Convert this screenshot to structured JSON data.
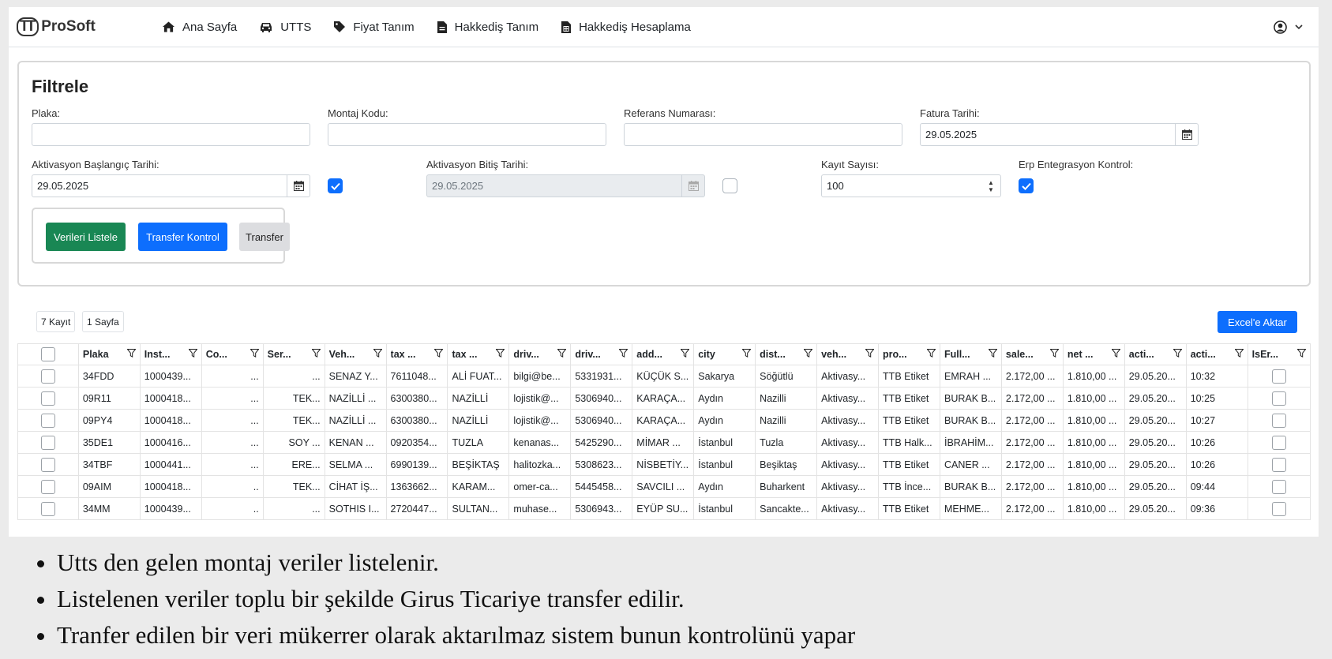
{
  "nav": {
    "logo_mark": "TT",
    "logo_text": "ProSoft",
    "items": [
      {
        "label": "Ana Sayfa",
        "icon": "home-icon"
      },
      {
        "label": "UTTS",
        "icon": "car-icon"
      },
      {
        "label": "Fiyat Tanım",
        "icon": "tag-icon"
      },
      {
        "label": "Hakkediş Tanım",
        "icon": "file-icon"
      },
      {
        "label": "Hakkediş Hesaplama",
        "icon": "calculator-file-icon"
      }
    ],
    "user_icon": "user-circle-icon"
  },
  "filter": {
    "title": "Filtrele",
    "plaka_label": "Plaka:",
    "plaka_value": "",
    "montaj_label": "Montaj Kodu:",
    "montaj_value": "",
    "referans_label": "Referans Numarası:",
    "referans_value": "",
    "fatura_label": "Fatura Tarihi:",
    "fatura_value": "29.05.2025",
    "akt_bas_label": "Aktivasyon Başlangıç Tarihi:",
    "akt_bas_value": "29.05.2025",
    "akt_bas_checked": true,
    "akt_bit_label": "Aktivasyon Bitiş Tarihi:",
    "akt_bit_value": "29.05.2025",
    "akt_bit_checked": false,
    "kayit_label": "Kayıt Sayısı:",
    "kayit_value": "100",
    "erp_label": "Erp Entegrasyon Kontrol:",
    "erp_checked": true,
    "btn_list": "Verileri Listele",
    "btn_transfer_kontrol": "Transfer Kontrol",
    "btn_transfer": "Transfer"
  },
  "grid": {
    "record_count": "7 Kayıt",
    "page_count": "1 Sayfa",
    "excel_button": "Excel'e Aktar",
    "columns": [
      "Plaka",
      "Inst...",
      "Co...",
      "Ser...",
      "Veh...",
      "tax ...",
      "tax ...",
      "driv...",
      "driv...",
      "add...",
      "city",
      "dist...",
      "veh...",
      "pro...",
      "Full...",
      "sale...",
      "net ...",
      "acti...",
      "acti...",
      "IsEr..."
    ],
    "rows": [
      [
        "34FDD",
        "1000439...",
        "...",
        "...",
        "SENAZ Y...",
        "7611048...",
        "ALİ FUAT...",
        "bilgi@be...",
        "5331931...",
        "KÜÇÜK S...",
        "Sakarya",
        "Söğütlü",
        "Aktivasy...",
        "TTB Etiket",
        "EMRAH ...",
        "2.172,00 ...",
        "1.810,00 ...",
        "29.05.20...",
        "10:32"
      ],
      [
        "09R11",
        "1000418...",
        "...",
        "TEK...",
        "NAZİLLİ ...",
        "6300380...",
        "NAZİLLİ",
        "lojistik@...",
        "5306940...",
        "KARAÇA...",
        "Aydın",
        "Nazilli",
        "Aktivasy...",
        "TTB Etiket",
        "BURAK B...",
        "2.172,00 ...",
        "1.810,00 ...",
        "29.05.20...",
        "10:25"
      ],
      [
        "09PY4",
        "1000418...",
        "...",
        "TEK...",
        "NAZİLLİ ...",
        "6300380...",
        "NAZİLLİ",
        "lojistik@...",
        "5306940...",
        "KARAÇA...",
        "Aydın",
        "Nazilli",
        "Aktivasy...",
        "TTB Etiket",
        "BURAK B...",
        "2.172,00 ...",
        "1.810,00 ...",
        "29.05.20...",
        "10:27"
      ],
      [
        "35DE1",
        "1000416...",
        "...",
        "SOY ...",
        "KENAN ...",
        "0920354...",
        "TUZLA",
        "kenanas...",
        "5425290...",
        "MİMAR ...",
        "İstanbul",
        "Tuzla",
        "Aktivasy...",
        "TTB Halk...",
        "İBRAHİM...",
        "2.172,00 ...",
        "1.810,00 ...",
        "29.05.20...",
        "10:26"
      ],
      [
        "34TBF",
        "1000441...",
        "...",
        "ERE...",
        "SELMA ...",
        "6990139...",
        "BEŞİKTAŞ",
        "halitozka...",
        "5308623...",
        "NİSBETİY...",
        "İstanbul",
        "Beşiktaş",
        "Aktivasy...",
        "TTB Etiket",
        "CANER ...",
        "2.172,00 ...",
        "1.810,00 ...",
        "29.05.20...",
        "10:26"
      ],
      [
        "09AIM",
        "1000418...",
        "..",
        "TEK...",
        "CİHAT İŞ...",
        "1363662...",
        "KARAM...",
        "omer-ca...",
        "5445458...",
        "SAVCILI ...",
        "Aydın",
        "Buharkent",
        "Aktivasy...",
        "TTB İnce...",
        "BURAK B...",
        "2.172,00 ...",
        "1.810,00 ...",
        "29.05.20...",
        "09:44"
      ],
      [
        "34MM",
        "1000439...",
        "..",
        "...",
        "SOTHIS I...",
        "2720447...",
        "SULTAN...",
        "muhase...",
        "5306943...",
        "EYÜP SU...",
        "İstanbul",
        "Sancakte...",
        "Aktivasy...",
        "TTB Etiket",
        "MEHME...",
        "2.172,00 ...",
        "1.810,00 ...",
        "29.05.20...",
        "09:36"
      ]
    ]
  },
  "notes": [
    "Utts den gelen montaj veriler listelenir.",
    "Listelenen veriler toplu bir şekilde Girus Ticariye transfer edilir.",
    "Tranfer edilen bir veri mükerrer olarak aktarılmaz sistem bunun kontrolünü yapar"
  ],
  "colors": {
    "primary": "#0d6efd",
    "success": "#198754",
    "secondary": "#dcdde0"
  }
}
